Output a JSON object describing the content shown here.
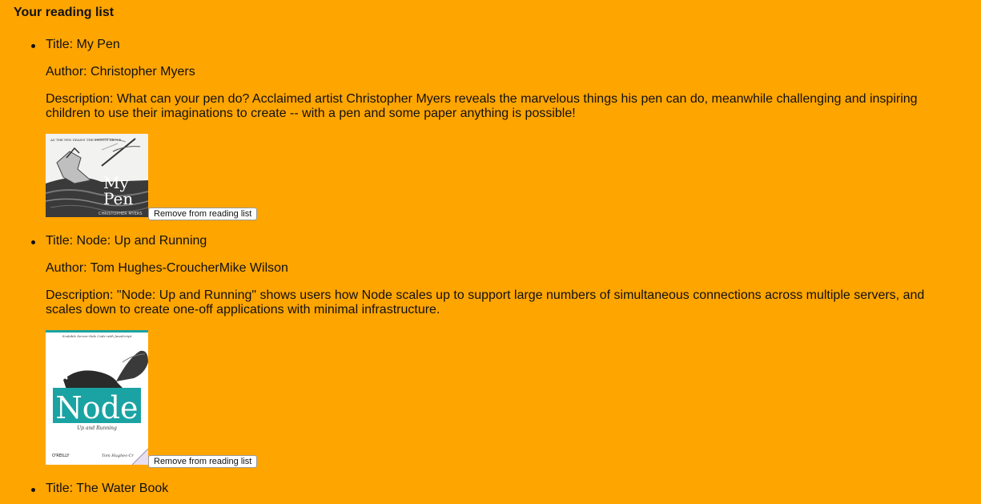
{
  "heading": "Your reading list",
  "books": [
    {
      "title": "Title: My Pen",
      "author": "Author: Christopher Myers",
      "description": "Description: What can your pen do? Acclaimed artist Christopher Myers reveals the marvelous things his pen can do, meanwhile challenging and inspiring children to use their imaginations to create -- with a pen and some paper anything is possible!",
      "cover_title_line1": "My",
      "cover_title_line2": "Pen",
      "cover_top_text": "AS THE PEN DRAWS THE THINGS ABOVE...",
      "cover_author_text": "CHRISTOPHER MYERS",
      "remove_label": "Remove from reading list"
    },
    {
      "title": "Title: Node: Up and Running",
      "author": "Author: Tom Hughes-CroucherMike Wilson",
      "description": "Description: \"Node: Up and Running\" shows users how Node scales up to support large numbers of simultaneous connections across multiple servers, and scales down to create one-off applications with minimal infrastructure.",
      "cover_tagline": "Scalable Server-Side Code with JavaScript",
      "cover_title": "Node",
      "cover_subtitle": "Up and Running",
      "cover_publisher": "O'REILLY",
      "cover_author_text": "Tom Hughes-Cr",
      "remove_label": "Remove from reading list"
    },
    {
      "title": "Title: The Water Book"
    }
  ],
  "colors": {
    "background": "#ffa500",
    "node_teal": "#1ba3a3"
  }
}
